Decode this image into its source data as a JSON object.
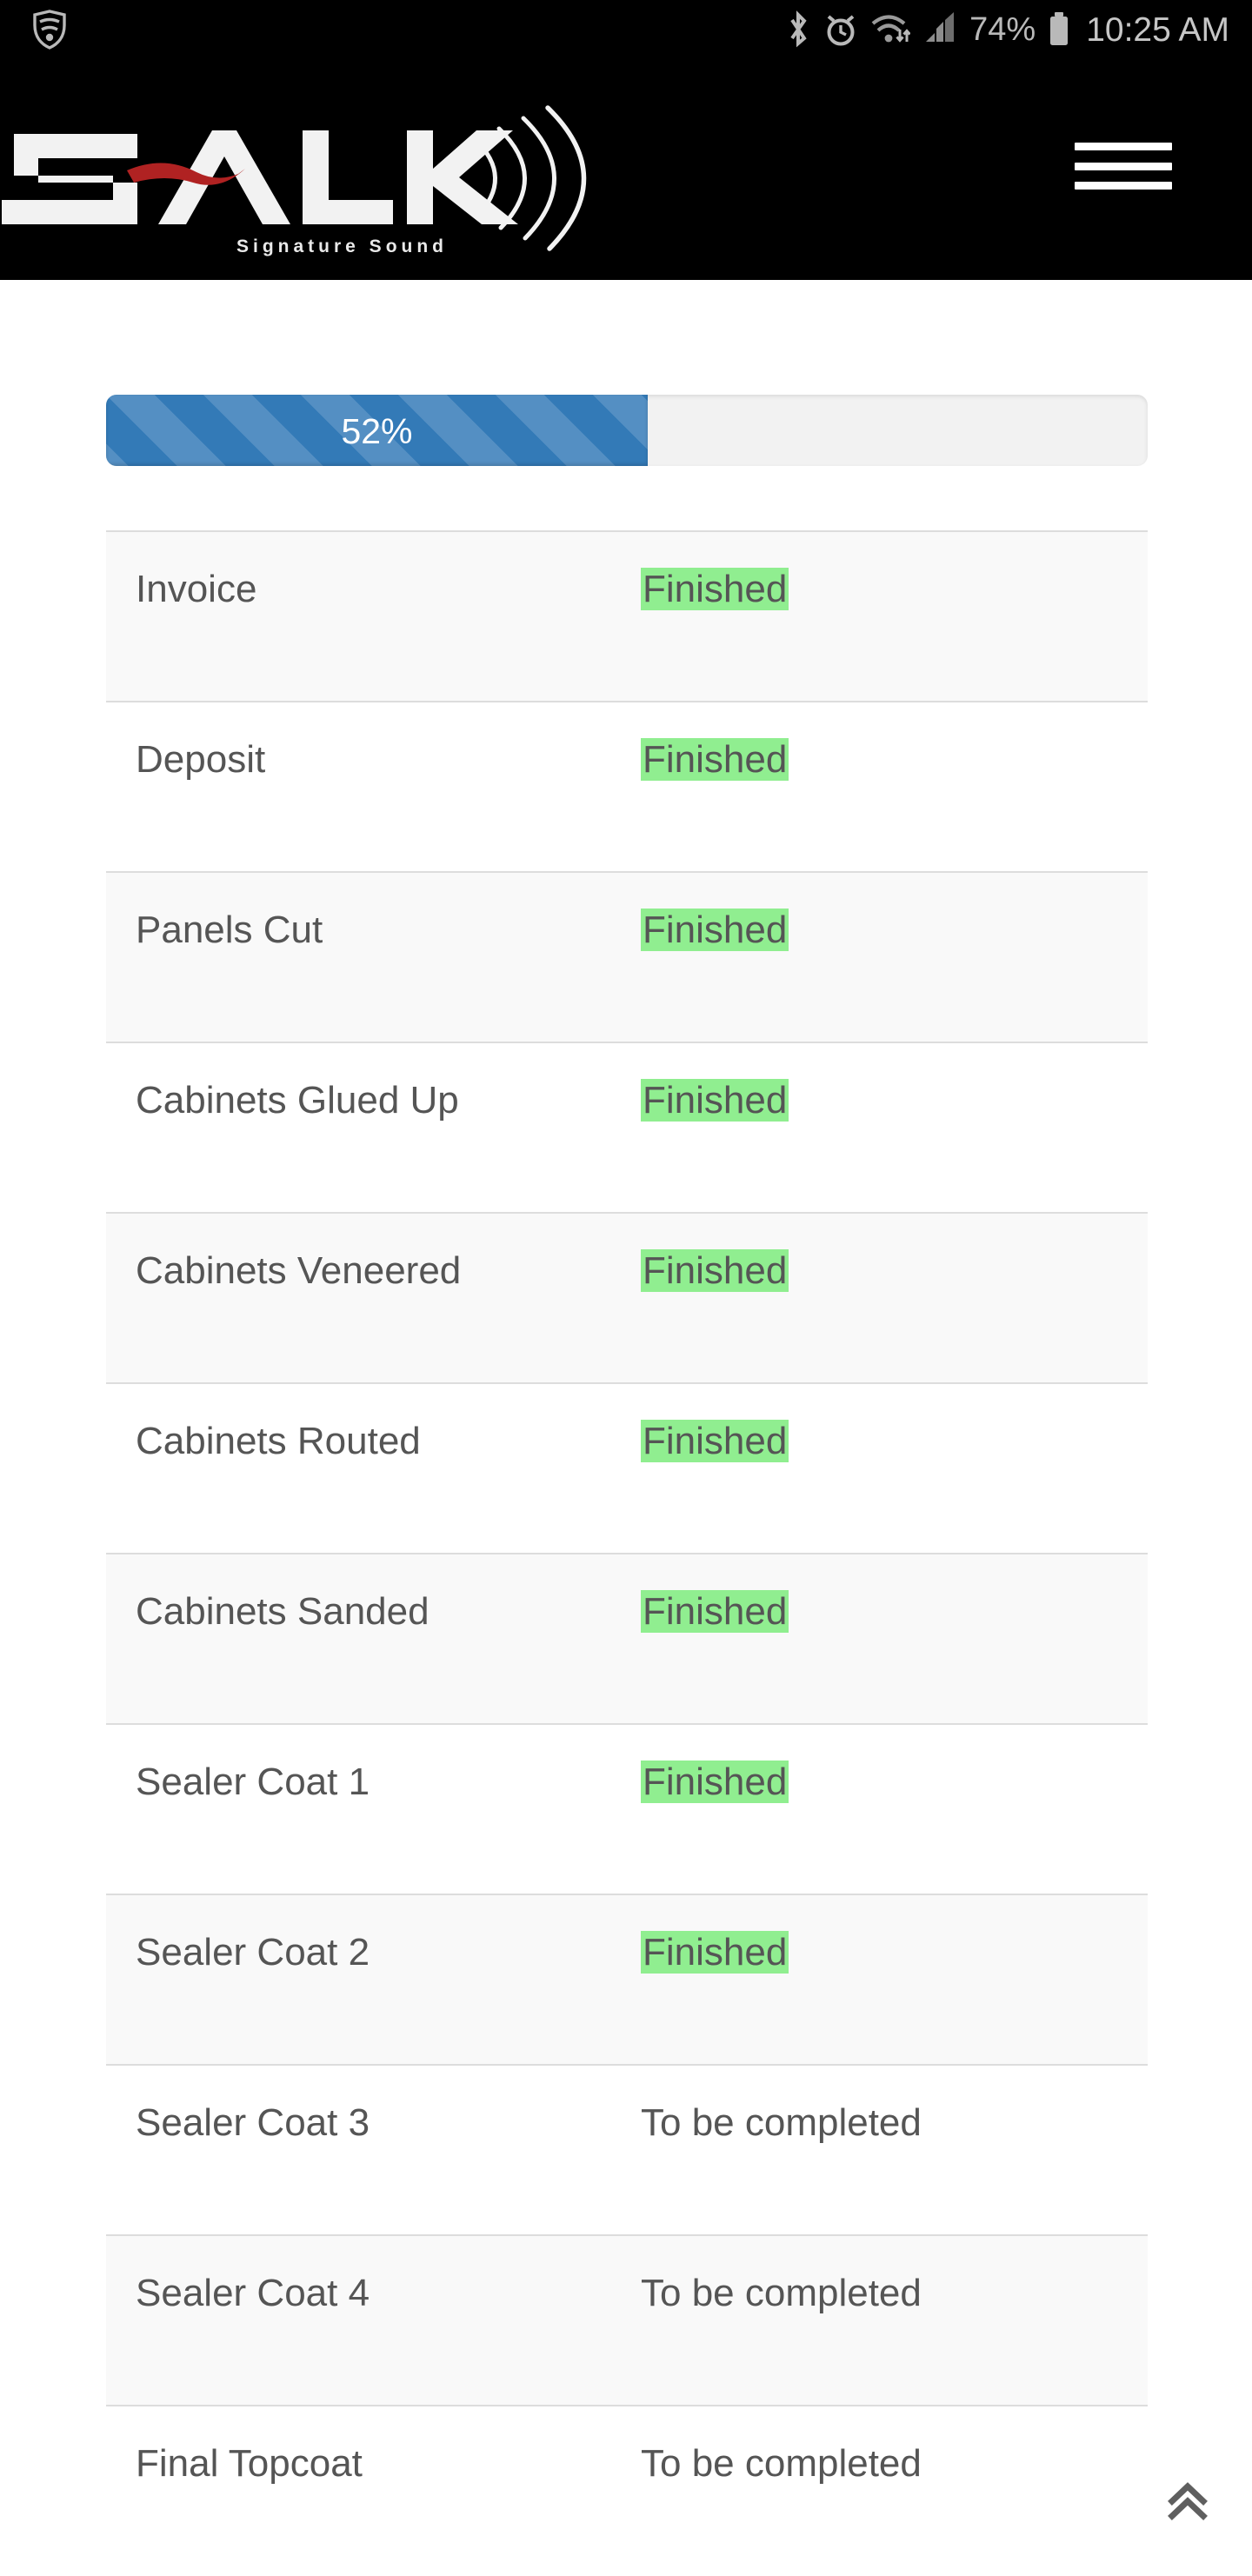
{
  "status_bar": {
    "vpn_icon": "shield-wifi-icon",
    "bluetooth_icon": "bluetooth-icon",
    "alarm_icon": "alarm-clock-icon",
    "wifi_icon": "wifi-icon",
    "signal_icon": "cellular-signal-icon",
    "battery_percent": "74%",
    "battery_icon": "battery-icon",
    "clock": "10:25 AM"
  },
  "header": {
    "brand_name": "SALK",
    "brand_tagline": "Signature Sound",
    "menu_label": "Menu",
    "logo_accent_color": "#b02222",
    "logo_color": "#ffffff",
    "background_color": "#000000"
  },
  "progress": {
    "percent_label": "52%",
    "percent_value": 52,
    "fill_color": "#337ab7",
    "track_color": "#f2f2f2"
  },
  "table": {
    "finished_highlight_color": "#90ee90",
    "rows": [
      {
        "task": "Invoice",
        "status": "Finished",
        "state": "finished"
      },
      {
        "task": "Deposit",
        "status": "Finished",
        "state": "finished"
      },
      {
        "task": "Panels Cut",
        "status": "Finished",
        "state": "finished"
      },
      {
        "task": "Cabinets Glued Up",
        "status": "Finished",
        "state": "finished"
      },
      {
        "task": "Cabinets Veneered",
        "status": "Finished",
        "state": "finished"
      },
      {
        "task": "Cabinets Routed",
        "status": "Finished",
        "state": "finished"
      },
      {
        "task": "Cabinets Sanded",
        "status": "Finished",
        "state": "finished"
      },
      {
        "task": "Sealer Coat 1",
        "status": "Finished",
        "state": "finished"
      },
      {
        "task": "Sealer Coat 2",
        "status": "Finished",
        "state": "finished"
      },
      {
        "task": "Sealer Coat 3",
        "status": "To be completed",
        "state": "pending"
      },
      {
        "task": "Sealer Coat 4",
        "status": "To be completed",
        "state": "pending"
      },
      {
        "task": "Final Topcoat",
        "status": "To be completed",
        "state": "pending"
      }
    ]
  },
  "scroll_top": {
    "icon": "double-chevron-up-icon",
    "color": "#5f5f5f"
  }
}
